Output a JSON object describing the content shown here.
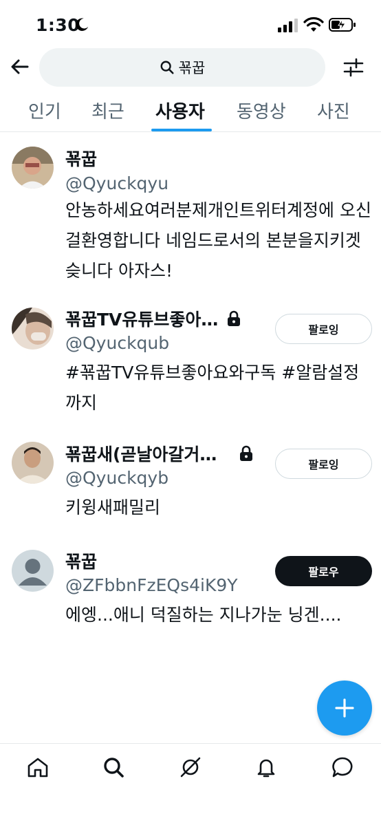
{
  "status_bar": {
    "time": "1:30",
    "icons": [
      "moon-icon",
      "cellular-signal-icon",
      "wifi-icon",
      "battery-charging-icon"
    ]
  },
  "header": {
    "back_icon": "arrow-left-icon",
    "search_query": "꾞꿉",
    "search_icon": "search-icon",
    "filter_icon": "sliders-icon"
  },
  "tabs": [
    {
      "label": "인기",
      "active": false
    },
    {
      "label": "최근",
      "active": false
    },
    {
      "label": "사용자",
      "active": true
    },
    {
      "label": "동영상",
      "active": false
    },
    {
      "label": "사진",
      "active": false
    }
  ],
  "users": [
    {
      "name": "꾞꿉",
      "handle": "@Qyuckqyu",
      "bio": "안농하세요여러분제개인트위터계정에 오신걸환영합니다 네임드로서의 본분을지키겟슺니다 아자스!",
      "locked": false,
      "button": ""
    },
    {
      "name": "꾞꿉TV유튜브좋아…",
      "handle": "@Qyuckqub",
      "bio": "#꾞꿉TV유튜브좋아요와구독 #알람설정까지",
      "locked": true,
      "button": "팔로잉"
    },
    {
      "name": "꾞꿉새(곧날아갈거…",
      "handle": "@Qyuckqyb",
      "bio": "키윙새패밀리",
      "locked": true,
      "button": "팔로잉"
    },
    {
      "name": "꾞꿉",
      "handle": "@ZFbbnFzEQs4iK9Y",
      "bio": "에엥...애니 덕질하는 지나가눈 닝겐....",
      "locked": false,
      "button": "팔로우"
    }
  ],
  "fab": {
    "icon": "plus-icon"
  },
  "bottom_nav": {
    "items": [
      "home-icon",
      "search-icon",
      "grok-icon",
      "bell-icon",
      "messages-icon"
    ]
  },
  "colors": {
    "accent": "#1d9bf0",
    "text_primary": "#0f1419",
    "text_secondary": "#536471",
    "search_bg": "#eff3f4"
  }
}
